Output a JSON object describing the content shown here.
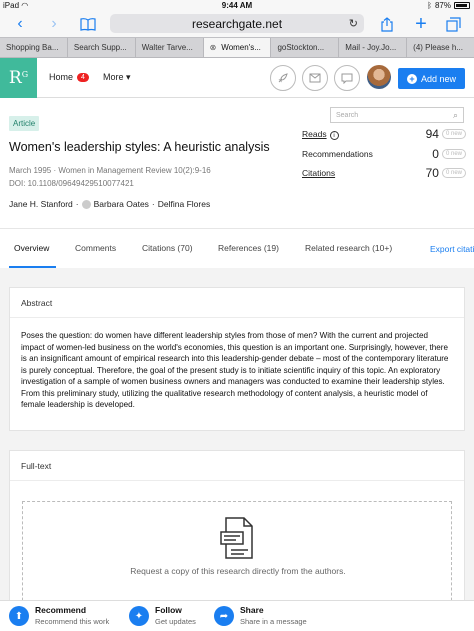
{
  "status": {
    "device": "iPad",
    "wifi": "wifi-icon",
    "time": "9:44 AM",
    "battery_pct": "87%"
  },
  "browser": {
    "url": "researchgate.net",
    "tabs": [
      "Shopping Ba...",
      "Search Supp...",
      "Walter Tarve...",
      "Women's...",
      "goStockton...",
      "Mail - Joy.Jo...",
      "(4) Please h..."
    ],
    "active_tab": 3
  },
  "rg": {
    "logo": "R",
    "logo_sup": "G",
    "home_label": "Home",
    "home_badge": "4",
    "more_label": "More",
    "add_new": "Add new"
  },
  "article": {
    "tag": "Article",
    "title": "Women's leadership styles: A heuristic analysis",
    "date_journal": "March 1995 · Women in Management Review 10(2):9-16",
    "doi": "DOI: 10.1108/09649429510077421",
    "author1": "Jane H. Stanford",
    "sep1": "·",
    "author2": "Barbara Oates",
    "sep2": "·",
    "author3": "Delfina Flores",
    "search_placeholder": "Search"
  },
  "stats": [
    {
      "label": "Reads",
      "value": "94",
      "new": "0 new"
    },
    {
      "label": "Recommendations",
      "value": "0",
      "new": "0 new"
    },
    {
      "label": "Citations",
      "value": "70",
      "new": "0 new"
    }
  ],
  "page_tabs": [
    "Overview",
    "Comments",
    "Citations (70)",
    "References (19)",
    "Related research (10+)"
  ],
  "export_label": "Export citati",
  "abstract": {
    "heading": "Abstract",
    "text": "Poses the question: do women have different leadership styles from those of men? With the current and projected impact of women-led business on the world's economies, this question is an important one. Surprisingly, however, there is an insignificant amount of empirical research into this leadership-gender debate – most of the contemporary literature is purely conceptual. Therefore, the goal of the present study is to initiate scientific inquiry of this topic. An exploratory investigation of a sample of women business owners and managers was conducted to examine their leadership styles. From this preliminary study, utilizing the qualitative research methodology of content analysis, a heuristic model of female leadership is developed."
  },
  "fulltext": {
    "heading": "Full-text",
    "request_text": "Request a copy of this research directly from the authors."
  },
  "bottom": {
    "recommend": {
      "title": "Recommend",
      "sub": "Recommend this work"
    },
    "follow": {
      "title": "Follow",
      "sub": "Get updates"
    },
    "share": {
      "title": "Share",
      "sub": "Share in a message"
    }
  },
  "colors": {
    "accent": "#1a7ef0",
    "brand": "#40ba9b",
    "badge": "#e22222"
  }
}
